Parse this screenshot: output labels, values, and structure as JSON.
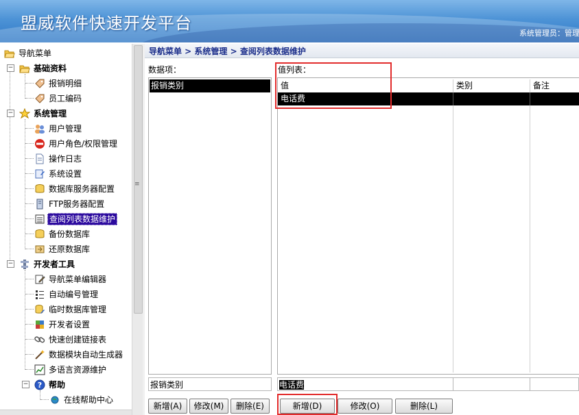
{
  "app": {
    "title": "盟威软件快速开发平台",
    "user_label": "系统管理员：管理"
  },
  "breadcrumb": "导航菜单 > 系统管理 > 查阅列表数据维护",
  "tree": {
    "root": "导航菜单",
    "groups": [
      {
        "label": "基础资料",
        "items": [
          "报销明细",
          "员工编码"
        ]
      },
      {
        "label": "系统管理",
        "items": [
          "用户管理",
          "用户角色/权限管理",
          "操作日志",
          "系统设置",
          "数据库服务器配置",
          "FTP服务器配置",
          "查阅列表数据维护",
          "备份数据库",
          "还原数据库"
        ]
      },
      {
        "label": "开发者工具",
        "items": [
          "导航菜单编辑器",
          "自动编号管理",
          "临时数据库管理",
          "开发者设置",
          "快速创建链接表",
          "数据模块自动生成器",
          "多语言资源维护"
        ]
      },
      {
        "label": "帮助",
        "items": [
          "在线帮助中心"
        ]
      }
    ],
    "selected": "查阅列表数据维护"
  },
  "data_items": {
    "label": "数据项：",
    "items": [
      "报销类别"
    ],
    "selected": "报销类别",
    "edit_value": "报销类别",
    "buttons": {
      "add": "新增(A)",
      "edit": "修改(M)",
      "delete": "删除(E)"
    }
  },
  "value_list": {
    "label": "值列表：",
    "columns": [
      "值",
      "类别",
      "备注"
    ],
    "rows": [
      [
        "电话费",
        "",
        ""
      ]
    ],
    "edit_value": "电话费",
    "buttons": {
      "add": "新增(D)",
      "edit": "修改(O)",
      "delete": "删除(L)"
    }
  },
  "colors": {
    "selection": "#2c0a9e",
    "highlight": "#e22b2b",
    "crumb_text": "#1a2d8a"
  }
}
